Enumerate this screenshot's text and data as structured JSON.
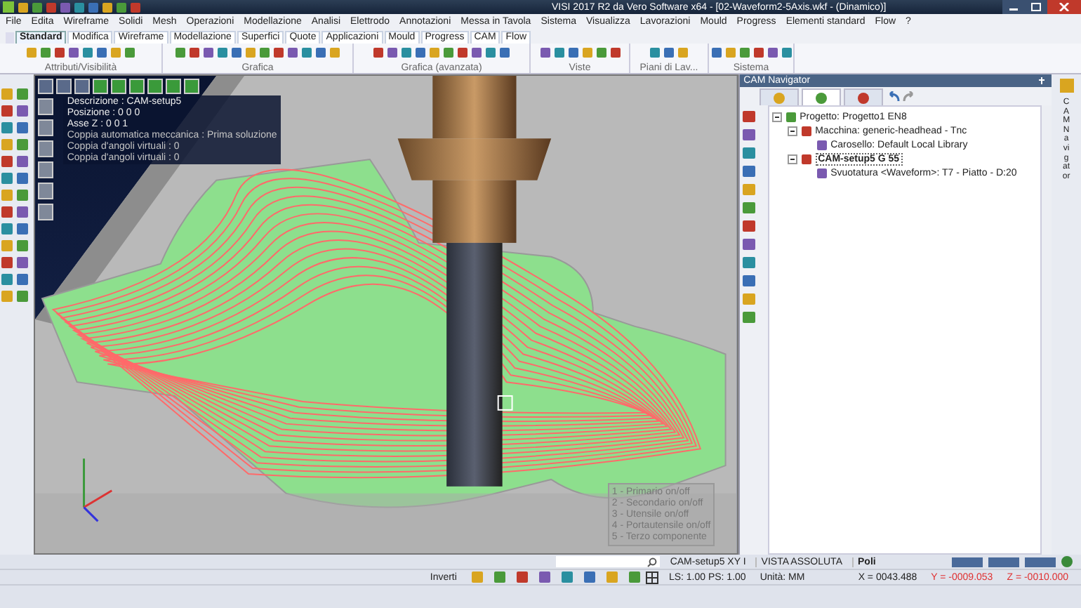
{
  "window": {
    "title": "VISI 2017 R2 da Vero Software x64 - [02-Waveform2-5Axis.wkf - (Dinamico)]"
  },
  "menu": [
    "File",
    "Edita",
    "Wireframe",
    "Solidi",
    "Mesh",
    "Operazioni",
    "Modellazione",
    "Analisi",
    "Elettrodo",
    "Annotazioni",
    "Messa in Tavola",
    "Sistema",
    "Visualizza",
    "Lavorazioni",
    "Mould",
    "Progress",
    "Elementi standard",
    "Flow",
    "?"
  ],
  "ribbon_tabs": [
    {
      "label": "Standard",
      "selected": true
    },
    {
      "label": "Modifica",
      "selected": false
    },
    {
      "label": "Wireframe",
      "selected": false
    },
    {
      "label": "Modellazione",
      "selected": false
    },
    {
      "label": "Superfici",
      "selected": false
    },
    {
      "label": "Quote",
      "selected": false
    },
    {
      "label": "Applicazioni",
      "selected": false
    },
    {
      "label": "Mould",
      "selected": false
    },
    {
      "label": "Progress",
      "selected": false
    },
    {
      "label": "CAM",
      "selected": false
    },
    {
      "label": "Flow",
      "selected": false
    }
  ],
  "ribbon_groups": [
    {
      "label": "Attributi/Visibilità"
    },
    {
      "label": "Grafica"
    },
    {
      "label": "Grafica (avanzata)"
    },
    {
      "label": "Viste"
    },
    {
      "label": "Piani di Lav..."
    },
    {
      "label": "Sistema"
    }
  ],
  "viewport": {
    "info": [
      "Descrizione : CAM-setup5",
      "Posizione : 0 0 0",
      "Asse Z : 0 0 1",
      "Coppia automatica meccanica : Prima soluzione",
      "Coppia d'angoli virtuali : 0",
      "Coppia d'angoli virtuali : 0"
    ],
    "legend": [
      "1 - Primario on/off",
      "2 - Secondario on/off",
      "3 - Utensile on/off",
      "4 - Portautensile on/off",
      "5 - Terzo componente"
    ]
  },
  "navigator": {
    "title": "CAM Navigator",
    "tabs": [
      {
        "selected": false
      },
      {
        "selected": true
      },
      {
        "selected": false
      }
    ],
    "tree": [
      {
        "label": "Progetto: Progetto1 EN8",
        "current": false,
        "expanded": true,
        "children": [
          {
            "label": "Macchina: generic-headhead - Tnc",
            "current": false,
            "expanded": true,
            "children": [
              {
                "label": "Carosello: Default Local Library",
                "current": false
              }
            ]
          },
          {
            "label": "CAM-setup5 G 55",
            "current": true,
            "expanded": true,
            "children": [
              {
                "label": "Svuotatura <Waveform>: T7 - Piatto - D:20",
                "current": false
              }
            ]
          }
        ]
      }
    ],
    "side_tab": "CAM Navigator"
  },
  "status": {
    "setup": "CAM-setup5 XY I",
    "view": "VISTA ASSOLUTA",
    "mode": "Poli",
    "invert": "Inverti",
    "scale": "LS: 1.00 PS: 1.00",
    "units": "Unità: MM",
    "x": "X = 0043.488",
    "y": "Y = -0009.053",
    "z": "Z = -0010.000"
  }
}
